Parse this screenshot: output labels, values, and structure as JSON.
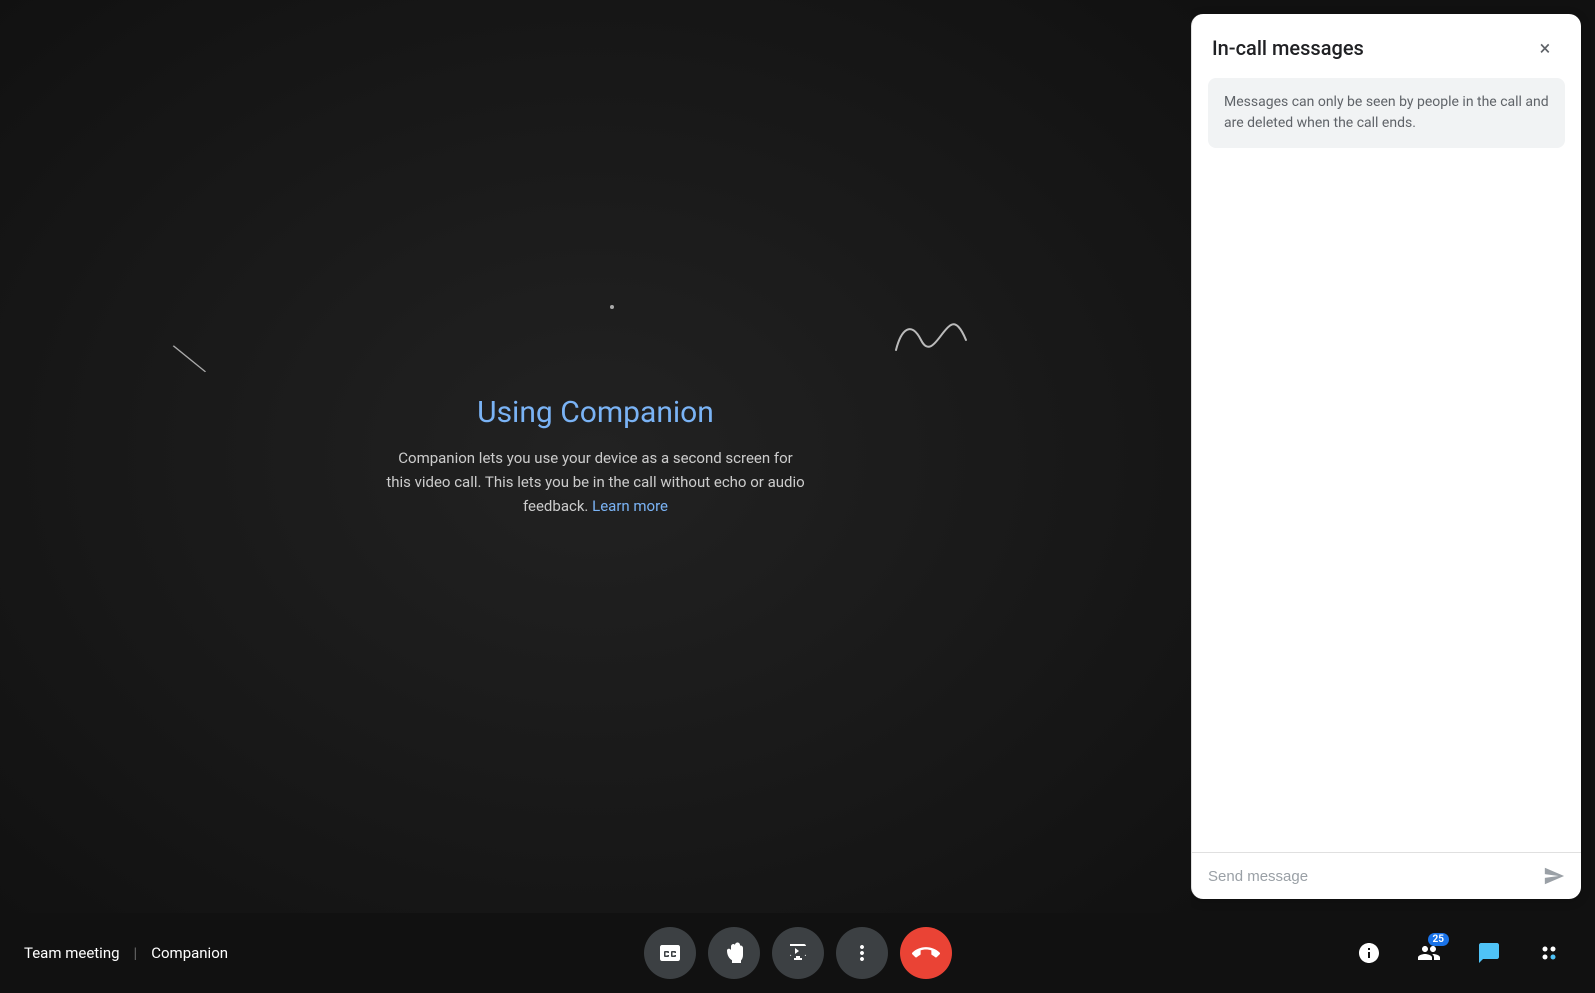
{
  "main": {
    "title": "Using Companion",
    "description": "Companion lets you use your device as a second screen for this video call. This lets you be in the call without echo or audio feedback.",
    "learn_more": "Learn more"
  },
  "panel": {
    "title": "In-call messages",
    "info_text": "Messages can only be seen by people in the call and are deleted when the call ends.",
    "close_label": "×",
    "send_placeholder": "Send message"
  },
  "bottom_bar": {
    "meeting_title": "Team meeting",
    "separator": "|",
    "companion_label": "Companion",
    "participants_badge": "25"
  },
  "controls": {
    "captions_label": "Captions",
    "raise_hand_label": "Raise hand",
    "present_label": "Present",
    "more_label": "More options",
    "end_call_label": "End call"
  },
  "right_controls": {
    "info_label": "Meeting info",
    "people_label": "People",
    "chat_label": "Chat",
    "activities_label": "Activities"
  }
}
